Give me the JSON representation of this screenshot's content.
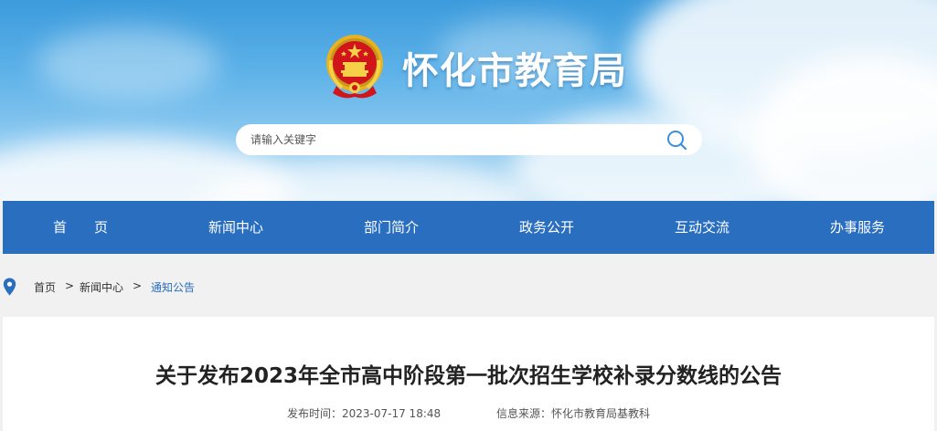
{
  "header": {
    "site_title": "怀化市教育局",
    "emblem_icon": "national-emblem-icon"
  },
  "search": {
    "placeholder": "请输入关键字",
    "value": "",
    "icon": "search-icon"
  },
  "nav": {
    "items": [
      {
        "label": "首　　页"
      },
      {
        "label": "新闻中心"
      },
      {
        "label": "部门简介"
      },
      {
        "label": "政务公开"
      },
      {
        "label": "互动交流"
      },
      {
        "label": "办事服务"
      }
    ]
  },
  "breadcrumb": {
    "icon": "location-pin-icon",
    "items": [
      {
        "label": "首页"
      },
      {
        "label": "新闻中心"
      },
      {
        "label": "通知公告"
      }
    ],
    "separator": ">"
  },
  "article": {
    "title": "关于发布2023年全市高中阶段第一批次招生学校补录分数线的公告",
    "publish_time": "发布时间：2023-07-17 18:48",
    "source": "信息来源：怀化市教育局基教科"
  },
  "colors": {
    "nav_background": "#2a6ec0",
    "breadcrumb_current": "#2a6ec0",
    "page_background": "#f1f1f1"
  }
}
